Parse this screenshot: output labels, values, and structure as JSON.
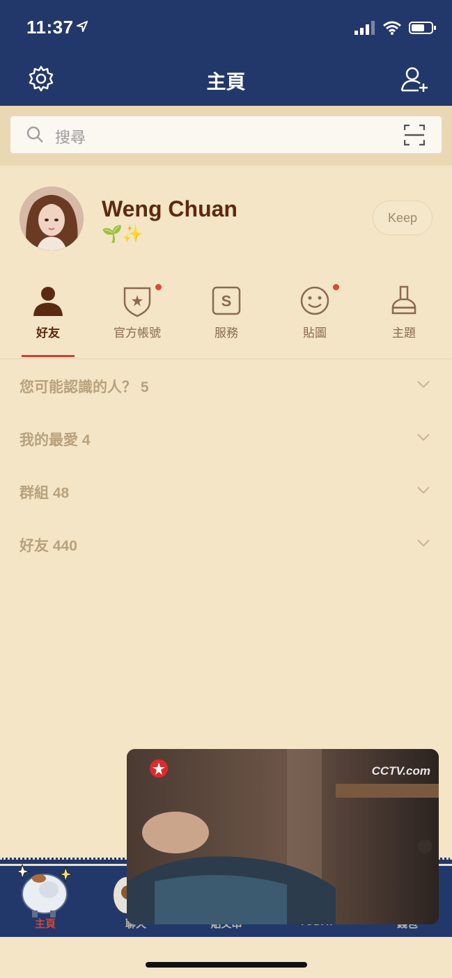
{
  "status_bar": {
    "time": "11:37",
    "icons": [
      "location-arrow-icon",
      "signal-icon",
      "wifi-icon",
      "battery-icon"
    ]
  },
  "nav": {
    "title": "主頁",
    "left_icon": "gear-icon",
    "right_icon": "add-friend-icon"
  },
  "search": {
    "placeholder": "搜尋",
    "scan_icon": "qr-scan-icon"
  },
  "profile": {
    "name": "Weng Chuan",
    "status": "🌱✨",
    "keep_label": "Keep"
  },
  "tabs": [
    {
      "label": "好友",
      "icon": "person-icon",
      "active": true,
      "badge": false
    },
    {
      "label": "官方帳號",
      "icon": "shield-star-icon",
      "active": false,
      "badge": true
    },
    {
      "label": "服務",
      "icon": "service-s-icon",
      "active": false,
      "badge": false
    },
    {
      "label": "貼圖",
      "icon": "smiley-icon",
      "active": false,
      "badge": true
    },
    {
      "label": "主題",
      "icon": "brush-icon",
      "active": false,
      "badge": false
    }
  ],
  "sections": [
    {
      "label": "您可能認識的人？ 5"
    },
    {
      "label": "我的最愛 4"
    },
    {
      "label": "群組 48"
    },
    {
      "label": "好友 440"
    }
  ],
  "bottom_tabs": [
    {
      "label": "主頁",
      "active": true
    },
    {
      "label": "聊天",
      "active": false
    },
    {
      "label": "貼文串",
      "active": false
    },
    {
      "label": "TODAY",
      "active": false
    },
    {
      "label": "錢包",
      "active": false
    }
  ],
  "video_pip": {
    "watermark": "CCTV.com"
  },
  "colors": {
    "nav_bg": "#23386a",
    "page_bg": "#f3e5c6",
    "accent": "#c7413a",
    "name_color": "#5c2a10"
  }
}
